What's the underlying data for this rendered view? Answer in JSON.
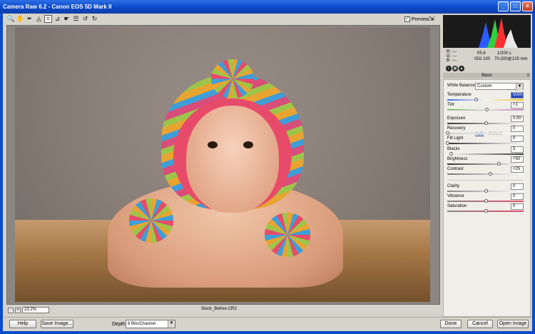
{
  "window": {
    "title": "Camera Raw 6.2  -  Canon EOS 5D Mark II",
    "minimize": "_",
    "maximize": "□",
    "close": "×"
  },
  "toolbar": {
    "tools": [
      {
        "name": "zoom-tool",
        "glyph": "🔍"
      },
      {
        "name": "hand-tool",
        "glyph": "✋"
      },
      {
        "name": "white-balance-tool",
        "glyph": "✒"
      },
      {
        "name": "color-sampler-tool",
        "glyph": "◬"
      },
      {
        "name": "crop-tool",
        "glyph": "⌗"
      },
      {
        "name": "straighten-tool",
        "glyph": "⊿"
      },
      {
        "name": "spot-removal-tool",
        "glyph": "☛"
      },
      {
        "name": "preferences-tool",
        "glyph": "☰"
      },
      {
        "name": "rotate-left-tool",
        "glyph": "↺"
      },
      {
        "name": "rotate-right-tool",
        "glyph": "↻"
      }
    ],
    "preview_label": "Preview",
    "preview_checked": "✓",
    "fullscreen_glyph": "⇲"
  },
  "status": {
    "zoom": "23.2%",
    "zoom_out": "-",
    "zoom_in": "+",
    "filename": "Stock_Before.CR2"
  },
  "bottom": {
    "help": "Help",
    "save_image": "Save Image...",
    "depth_label": "Depth:",
    "depth_value": "8 Bits/Channel",
    "done": "Done",
    "cancel": "Cancel",
    "open_image": "Open Image"
  },
  "info": {
    "r_label": "R:",
    "r_value": "---",
    "g_label": "G:",
    "g_value": "---",
    "b_label": "B:",
    "b_value": "---",
    "aperture": "f/5.6",
    "shutter": "1/200 s",
    "iso": "ISO 100",
    "lens": "70-200@125 mm"
  },
  "panel": {
    "section_title": "Basic",
    "white_balance_label": "White Balance:",
    "white_balance_value": "Custom",
    "auto": "Auto",
    "default": "Default",
    "sliders": [
      {
        "label": "Temperature",
        "value": "5000",
        "position": 0.37
      },
      {
        "label": "Tint",
        "value": "+1",
        "position": 0.51
      },
      {
        "label": "Exposure",
        "value": "0.00",
        "position": 0.5
      },
      {
        "label": "Recovery",
        "value": "0",
        "position": 0.0
      },
      {
        "label": "Fill Light",
        "value": "0",
        "position": 0.0
      },
      {
        "label": "Blacks",
        "value": "5",
        "position": 0.05
      },
      {
        "label": "Brightness",
        "value": "+50",
        "position": 0.67
      },
      {
        "label": "Contrast",
        "value": "+25",
        "position": 0.56
      },
      {
        "label": "Clarity",
        "value": "0",
        "position": 0.5
      },
      {
        "label": "Vibrance",
        "value": "0",
        "position": 0.5
      },
      {
        "label": "Saturation",
        "value": "0",
        "position": 0.5
      }
    ]
  },
  "colors": {
    "title_bar": "#0a49c9",
    "panel_bg": "#efeee8",
    "accent": "#2a4ab8"
  }
}
